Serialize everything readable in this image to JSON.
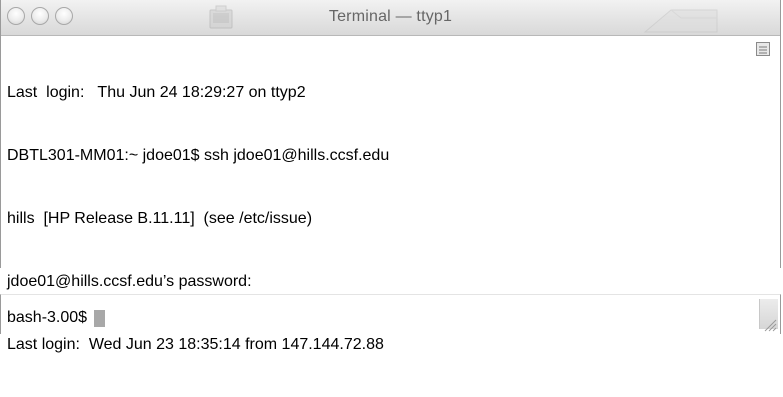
{
  "window": {
    "title": "Terminal — ttyp1"
  },
  "terminal": {
    "lines": [
      "Last  login:   Thu Jun 24 18:29:27 on ttyp2",
      "DBTL301-MM01:~ jdoe01$ ssh jdoe01@hills.ccsf.edu",
      "hills  [HP Release B.11.11]  (see /etc/issue)",
      "jdoe01@hills.ccsf.edu’s password:",
      "Last login:  Wed Jun 23 18:35:14 from 147.144.72.88"
    ],
    "prompt": "bash-3.00$ "
  },
  "icons": {
    "close": "close-button-icon",
    "minimize": "minimize-button-icon",
    "zoom": "zoom-button-icon",
    "proxy": "terminal-proxy-icon",
    "scroll": "scroll-indicator-icon",
    "resize": "resize-grip-icon"
  },
  "colors": {
    "titlebar_top": "#f2f2f2",
    "titlebar_bottom": "#d9d9d9",
    "text": "#000000",
    "title_text": "#666666",
    "cursor": "#a8a8a8"
  }
}
